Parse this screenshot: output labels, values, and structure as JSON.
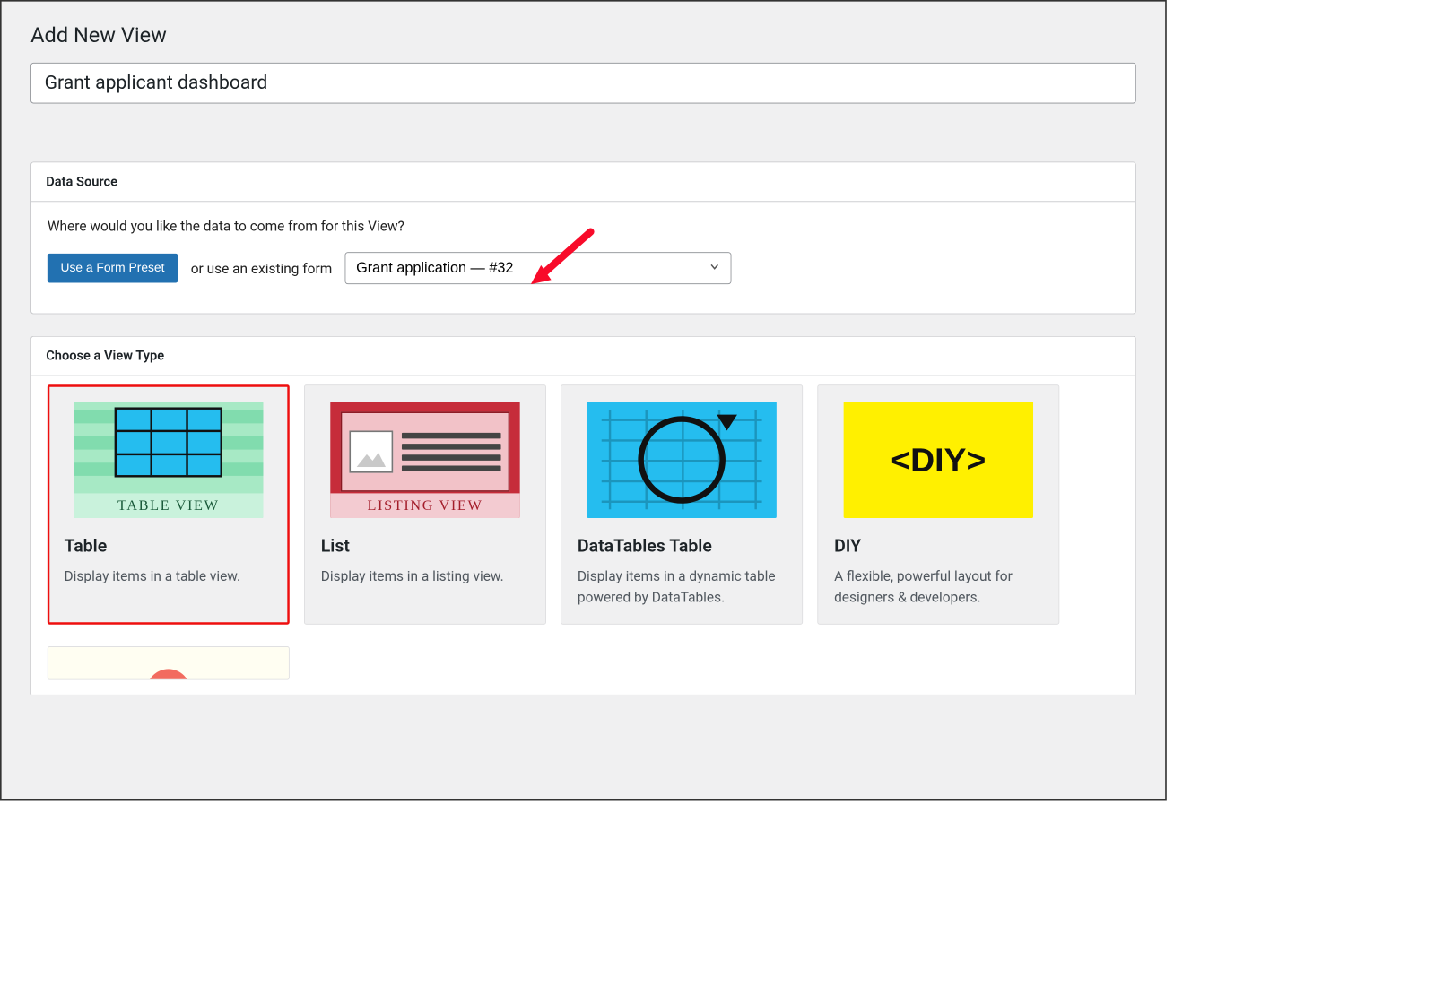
{
  "page": {
    "title": "Add New View"
  },
  "title_input": {
    "value": "Grant applicant dashboard"
  },
  "data_source": {
    "panel_title": "Data Source",
    "question": "Where would you like the data to come from for this View?",
    "preset_button": "Use a Form Preset",
    "or_text": "or use an existing form",
    "selected_form": "Grant application — #32"
  },
  "view_type": {
    "panel_title": "Choose a View Type",
    "cards": [
      {
        "thumb_caption": "TABLE VIEW",
        "title": "Table",
        "desc": "Display items in a table view."
      },
      {
        "thumb_caption": "LISTING VIEW",
        "title": "List",
        "desc": "Display items in a listing view."
      },
      {
        "thumb_caption": "",
        "title": "DataTables Table",
        "desc": "Display items in a dynamic table powered by DataTables."
      },
      {
        "thumb_caption": "<DIY>",
        "title": "DIY",
        "desc": "A flexible, powerful layout for designers & developers."
      }
    ]
  }
}
